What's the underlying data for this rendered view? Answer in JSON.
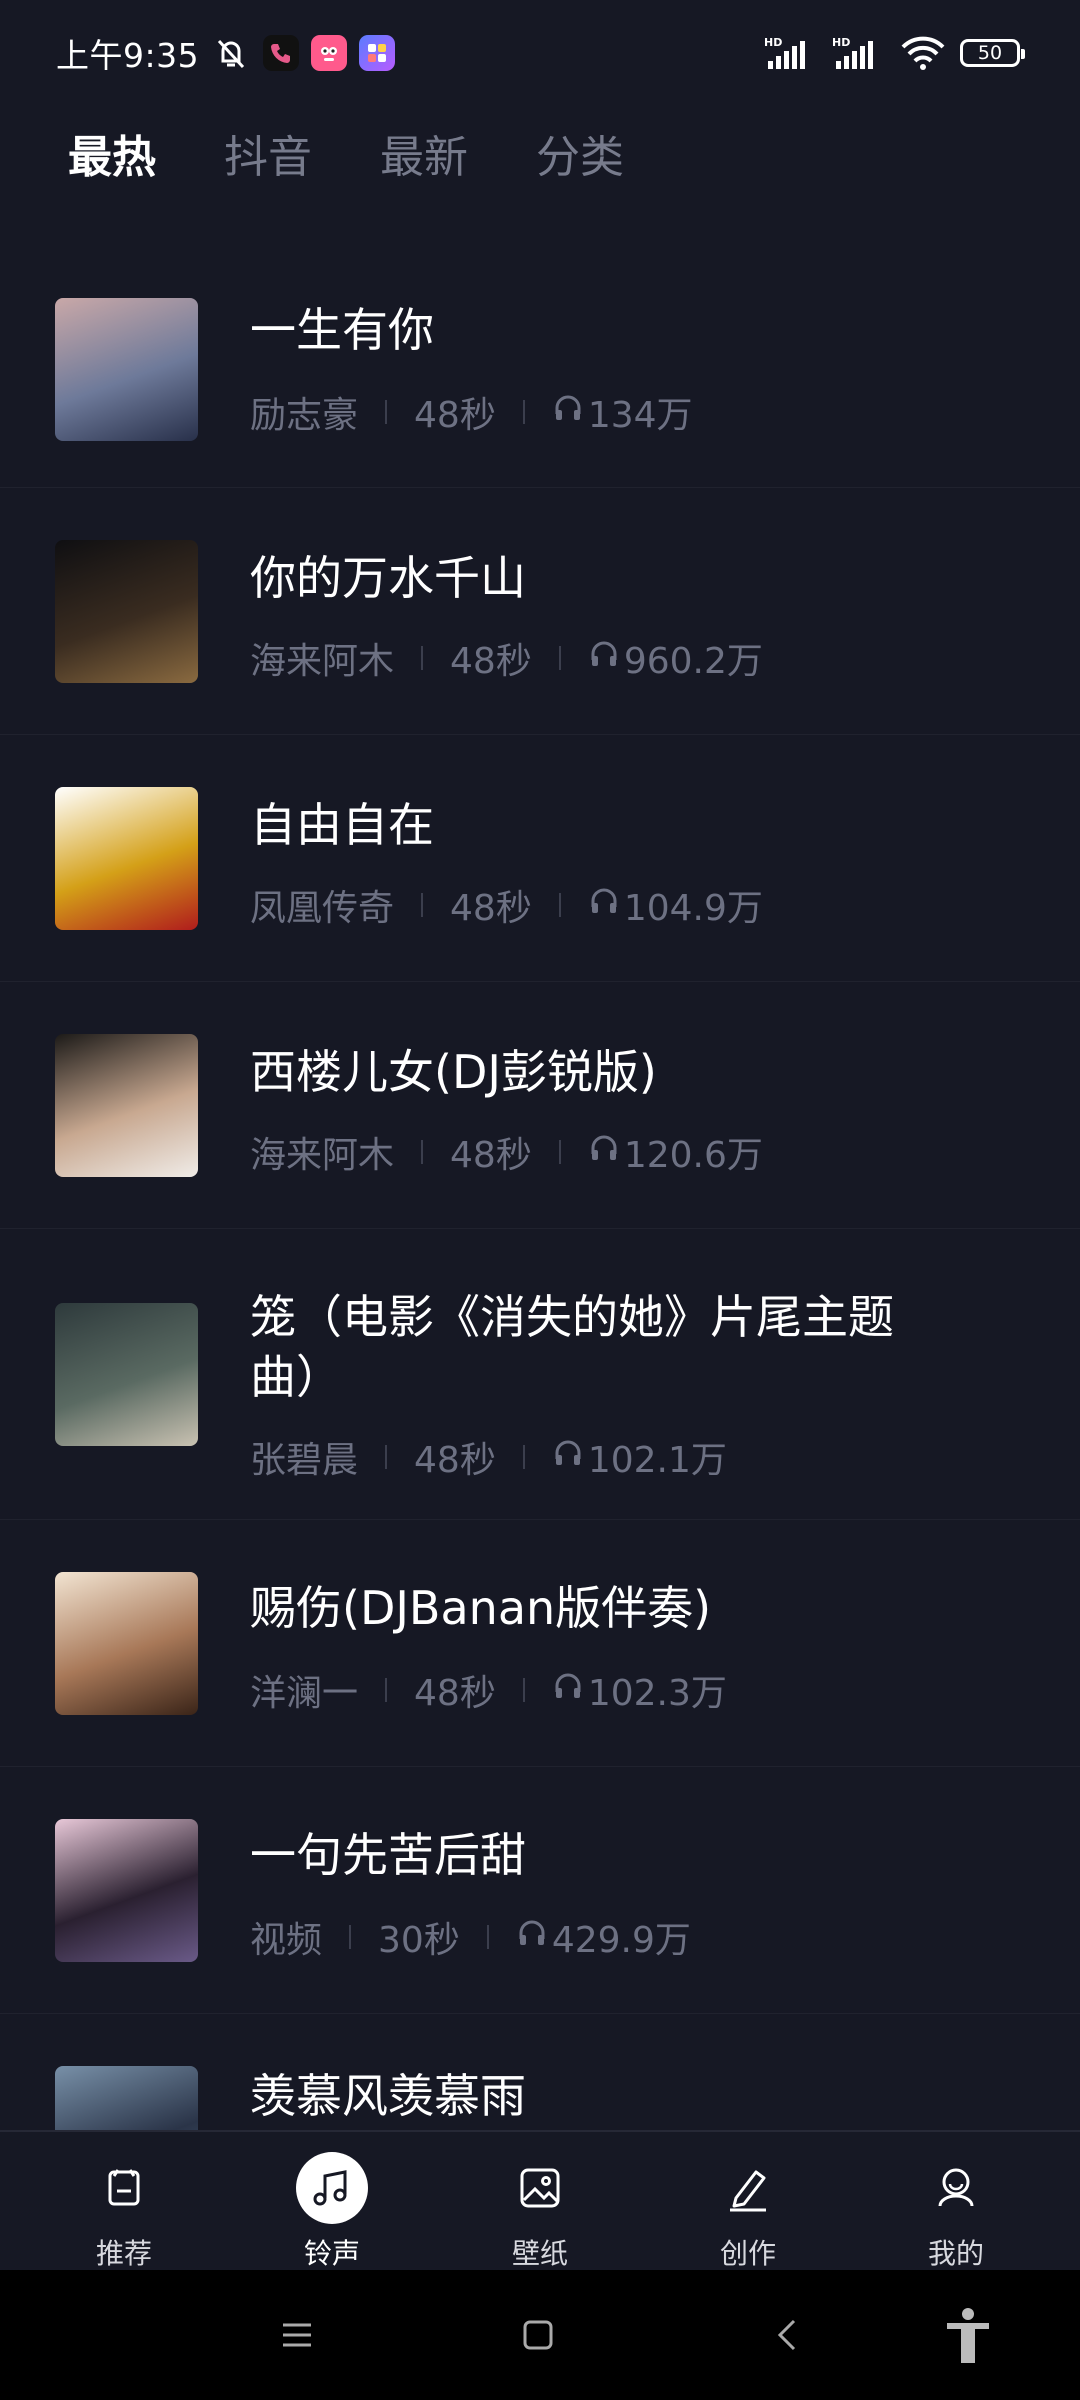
{
  "status_bar": {
    "time": "上午9:35",
    "battery": "50",
    "left_icons": [
      "mute-bell-icon",
      "phone-app-icon",
      "pink-app-icon",
      "widget-app-icon"
    ],
    "right_icons": [
      "hd-signal-icon",
      "hd-signal-icon",
      "wifi-icon",
      "battery-icon"
    ]
  },
  "tabs": [
    {
      "label": "最热",
      "active": true
    },
    {
      "label": "抖音",
      "active": false
    },
    {
      "label": "最新",
      "active": false
    },
    {
      "label": "分类",
      "active": false
    }
  ],
  "songs": [
    {
      "title": "一生有你",
      "artist": "励志豪",
      "duration": "48秒",
      "plays": "134万",
      "cover_colors": [
        "#c9a8a8",
        "#6e7a9a",
        "#28304a"
      ]
    },
    {
      "title": "你的万水千山",
      "artist": "海来阿木",
      "duration": "48秒",
      "plays": "960.2万",
      "cover_colors": [
        "#0f0f12",
        "#3a2c20",
        "#8a6a40"
      ]
    },
    {
      "title": "自由自在",
      "artist": "凤凰传奇",
      "duration": "48秒",
      "plays": "104.9万",
      "cover_colors": [
        "#ffffff",
        "#d4a018",
        "#b01c1c"
      ]
    },
    {
      "title": "西楼儿女(DJ彭锐版)",
      "artist": "海来阿木",
      "duration": "48秒",
      "plays": "120.6万",
      "cover_colors": [
        "#1c1a18",
        "#c8a890",
        "#f0ece8"
      ]
    },
    {
      "title": "笼（电影《消失的她》片尾主题曲）",
      "artist": "张碧晨",
      "duration": "48秒",
      "plays": "102.1万",
      "cover_colors": [
        "#2e3a3c",
        "#5a6a62",
        "#c9c2b2"
      ]
    },
    {
      "title": "赐伤(DJBanan版伴奏)",
      "artist": "洋澜一",
      "duration": "48秒",
      "plays": "102.3万",
      "cover_colors": [
        "#f2e4d2",
        "#a87858",
        "#3a2418"
      ]
    },
    {
      "title": "一句先苦后甜",
      "artist": "视频",
      "duration": "30秒",
      "plays": "429.9万",
      "cover_colors": [
        "#e8c8d8",
        "#2a2030",
        "#6a5a88"
      ]
    },
    {
      "title": "羡慕风羡慕雨",
      "artist": "",
      "duration": "",
      "plays": "",
      "cover_colors": [
        "#7890a8",
        "#2a3448",
        "#506880"
      ]
    }
  ],
  "bottom_nav": [
    {
      "label": "推荐",
      "icon": "recommend-icon",
      "active": false
    },
    {
      "label": "铃声",
      "icon": "music-note-icon",
      "active": true
    },
    {
      "label": "壁纸",
      "icon": "wallpaper-icon",
      "active": false
    },
    {
      "label": "创作",
      "icon": "pen-icon",
      "active": false
    },
    {
      "label": "我的",
      "icon": "profile-icon",
      "active": false
    }
  ],
  "system_nav": [
    "menu-icon",
    "home-icon",
    "back-icon",
    "accessibility-icon"
  ]
}
